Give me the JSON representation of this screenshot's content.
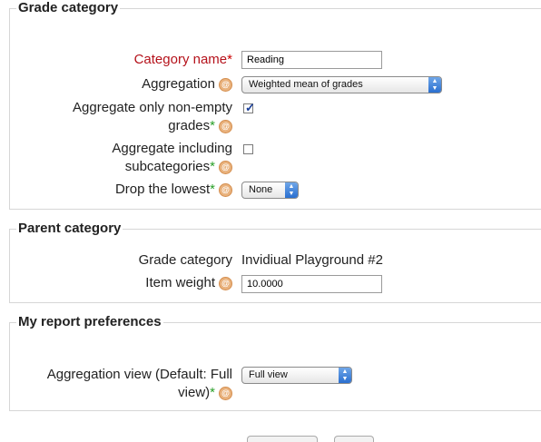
{
  "grade_category": {
    "legend": "Grade category",
    "category_name": {
      "label": "Category name",
      "required_mark": "*",
      "value": "Reading"
    },
    "aggregation": {
      "label": "Aggregation",
      "selected": "Weighted mean of grades"
    },
    "aggregate_nonempty": {
      "label_line1": "Aggregate only non-empty",
      "label_line2": "grades",
      "adv_mark": "*",
      "checked": true
    },
    "aggregate_subcats": {
      "label_line1": "Aggregate including",
      "label_line2": "subcategories",
      "adv_mark": "*",
      "checked": false
    },
    "drop_lowest": {
      "label": "Drop the lowest",
      "adv_mark": "*",
      "selected": "None"
    }
  },
  "parent_category": {
    "legend": "Parent category",
    "grade_category": {
      "label": "Grade category",
      "value": "Invidiual Playground #2"
    },
    "item_weight": {
      "label": "Item weight",
      "value": "10.0000"
    }
  },
  "report_prefs": {
    "legend": "My report preferences",
    "aggregation_view": {
      "label_line1": "Aggregation view (Default: Full",
      "label_line2": "view)",
      "adv_mark": "*",
      "selected": "Full view"
    }
  },
  "icons": {
    "help": "help-icon",
    "checkmark": "checkmark-icon",
    "select_arrows": "select-arrows-icon"
  },
  "colors": {
    "required": "#cc0000",
    "advanced": "#2aa02a",
    "help_bg": "#e9b27d",
    "select_arrows": "#2a6fd0"
  }
}
